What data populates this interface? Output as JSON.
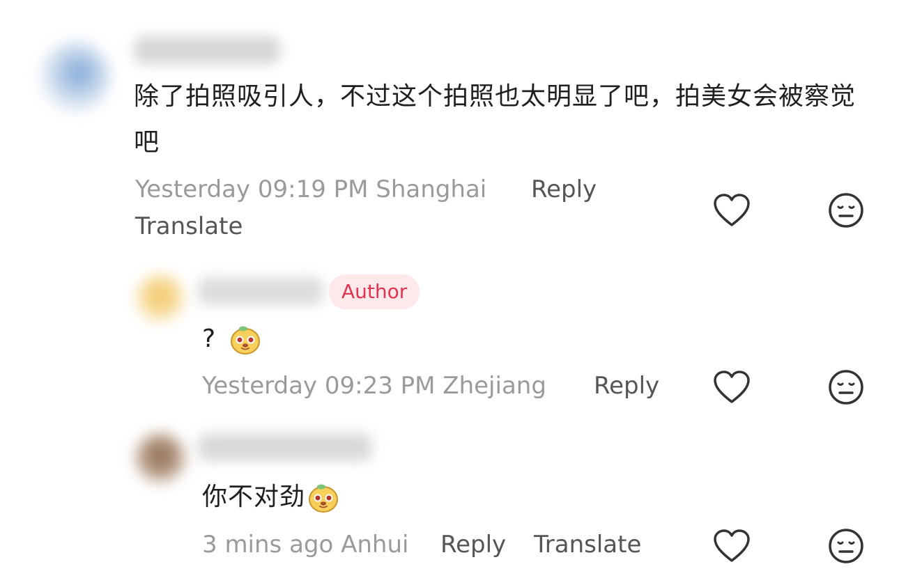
{
  "comments": [
    {
      "text": "除了拍照吸引人，不过这个拍照也太明显了吧，拍美女会被察觉吧",
      "meta": "Yesterday 09:19 PM Shanghai",
      "reply_label": "Reply",
      "translate_label": "Translate"
    },
    {
      "badge": "Author",
      "text": "?",
      "meta": "Yesterday 09:23 PM Zhejiang",
      "reply_label": "Reply"
    },
    {
      "text": "你不对劲",
      "meta": "3 mins ago Anhui",
      "reply_label": "Reply",
      "translate_label": "Translate"
    }
  ],
  "colors": {
    "author_badge_bg": "#fde8ea",
    "author_badge_text": "#e0344f",
    "meta_text": "#9a9a9a",
    "action_text": "#555555"
  },
  "icons": [
    "heart-outline-icon",
    "neutral-face-icon",
    "sticker-emoji"
  ]
}
